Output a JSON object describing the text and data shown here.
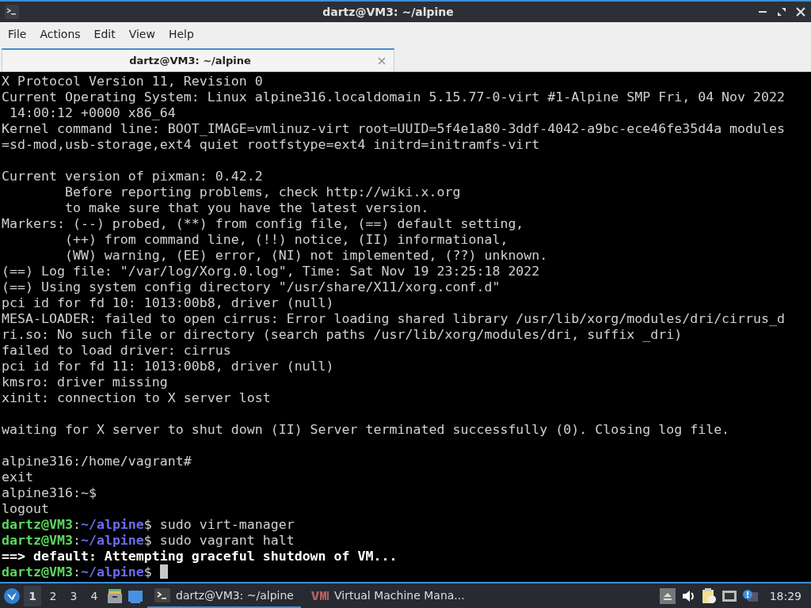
{
  "window": {
    "title": "dartz@VM3: ~/alpine"
  },
  "menu": [
    "File",
    "Actions",
    "Edit",
    "View",
    "Help"
  ],
  "tabs": [
    {
      "label": "dartz@VM3: ~/alpine",
      "selected": true
    }
  ],
  "terminal": {
    "lines": [
      {
        "kind": "output",
        "text": "X Protocol Version 11, Revision 0"
      },
      {
        "kind": "output",
        "text": "Current Operating System: Linux alpine316.localdomain 5.15.77-0-virt #1-Alpine SMP Fri, 04 Nov 2022"
      },
      {
        "kind": "output",
        "text": " 14:00:12 +0000 x86_64"
      },
      {
        "kind": "output",
        "text": "Kernel command line: BOOT_IMAGE=vmlinuz-virt root=UUID=5f4e1a80-3ddf-4042-a9bc-ece46fe35d4a modules"
      },
      {
        "kind": "output",
        "text": "=sd-mod,usb-storage,ext4 quiet rootfstype=ext4 initrd=initramfs-virt"
      },
      {
        "kind": "blank"
      },
      {
        "kind": "output",
        "text": "Current version of pixman: 0.42.2"
      },
      {
        "kind": "output",
        "text": "        Before reporting problems, check http://wiki.x.org"
      },
      {
        "kind": "output",
        "text": "        to make sure that you have the latest version."
      },
      {
        "kind": "output",
        "text": "Markers: (--) probed, (**) from config file, (==) default setting,"
      },
      {
        "kind": "output",
        "text": "        (++) from command line, (!!) notice, (II) informational,"
      },
      {
        "kind": "output",
        "text": "        (WW) warning, (EE) error, (NI) not implemented, (??) unknown."
      },
      {
        "kind": "output",
        "text": "(==) Log file: \"/var/log/Xorg.0.log\", Time: Sat Nov 19 23:25:18 2022"
      },
      {
        "kind": "output",
        "text": "(==) Using system config directory \"/usr/share/X11/xorg.conf.d\""
      },
      {
        "kind": "output",
        "text": "pci id for fd 10: 1013:00b8, driver (null)"
      },
      {
        "kind": "output",
        "text": "MESA-LOADER: failed to open cirrus: Error loading shared library /usr/lib/xorg/modules/dri/cirrus_d"
      },
      {
        "kind": "output",
        "text": "ri.so: No such file or directory (search paths /usr/lib/xorg/modules/dri, suffix _dri)"
      },
      {
        "kind": "output",
        "text": "failed to load driver: cirrus"
      },
      {
        "kind": "output",
        "text": "pci id for fd 11: 1013:00b8, driver (null)"
      },
      {
        "kind": "output",
        "text": "kmsro: driver missing"
      },
      {
        "kind": "output",
        "text": "xinit: connection to X server lost"
      },
      {
        "kind": "blank"
      },
      {
        "kind": "output",
        "text": "waiting for X server to shut down (II) Server terminated successfully (0). Closing log file."
      },
      {
        "kind": "blank"
      },
      {
        "kind": "output",
        "text": "alpine316:/home/vagrant#"
      },
      {
        "kind": "output",
        "text": "exit"
      },
      {
        "kind": "output",
        "text": "alpine316:~$"
      },
      {
        "kind": "output",
        "text": "logout"
      },
      {
        "kind": "prompt",
        "user": "dartz@VM3",
        "separator": ":",
        "path": "~/alpine",
        "sign": "$",
        "command": " sudo virt-manager"
      },
      {
        "kind": "prompt",
        "user": "dartz@VM3",
        "separator": ":",
        "path": "~/alpine",
        "sign": "$",
        "command": " sudo vagrant halt"
      },
      {
        "kind": "bold",
        "text": "==> default: Attempting graceful shutdown of VM..."
      },
      {
        "kind": "prompt",
        "user": "dartz@VM3",
        "separator": ":",
        "path": "~/alpine",
        "sign": "$",
        "cursor": true
      }
    ]
  },
  "taskbar": {
    "workspaces": [
      {
        "label": "1",
        "selected": true
      },
      {
        "label": "2",
        "selected": false
      },
      {
        "label": "3",
        "selected": false
      },
      {
        "label": "4",
        "selected": false
      }
    ],
    "tasks": [
      {
        "kind": "terminal",
        "label": "dartz@VM3: ~/alpine",
        "selected": true
      },
      {
        "kind": "vm",
        "label": "Virtual Machine Mana...",
        "selected": false
      }
    ],
    "clock": "18:29"
  }
}
